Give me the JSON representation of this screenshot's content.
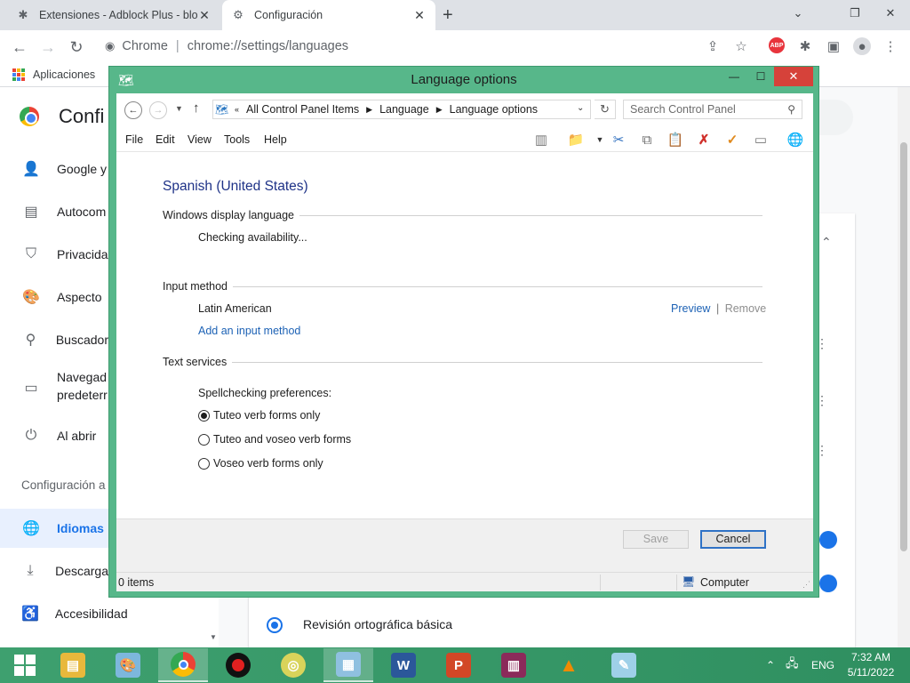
{
  "browser": {
    "tabs": [
      {
        "label": "Extensiones - Adblock Plus - bloq",
        "icon": "puzzle-icon"
      },
      {
        "label": "Configuración",
        "icon": "gear-icon"
      }
    ],
    "omnibox_site": "Chrome",
    "omnibox_url": "chrome://settings/languages",
    "bookmark_apps": "Aplicaciones",
    "abp_label": "ABP"
  },
  "settings": {
    "title": "Confi",
    "sidebar": [
      {
        "label": "Google y",
        "icon": "person-icon"
      },
      {
        "label": "Autocom",
        "icon": "clipboard-icon"
      },
      {
        "label": "Privacida",
        "icon": "shield-icon"
      },
      {
        "label": "Aspecto",
        "icon": "palette-icon"
      },
      {
        "label": "Buscador",
        "icon": "search-icon"
      },
      {
        "label": "Navegad",
        "label2": "predeterr",
        "icon": "browser-icon"
      },
      {
        "label": "Al abrir",
        "icon": "power-icon"
      }
    ],
    "sidebar_section": "Configuración a",
    "sidebar_bottom": [
      {
        "label": "Idiomas",
        "icon": "globe-icon",
        "active": true
      },
      {
        "label": "Descarga",
        "icon": "download-icon"
      },
      {
        "label": "Accesibilidad",
        "icon": "accessibility-icon"
      }
    ],
    "spellcheck_option": "Revisión ortográfica básica"
  },
  "dialog": {
    "title": "Language options",
    "breadcrumb": [
      "All Control Panel Items",
      "Language",
      "Language options"
    ],
    "breadcrumb_prefix": "«",
    "search_placeholder": "Search Control Panel",
    "menu": [
      "File",
      "Edit",
      "View",
      "Tools",
      "Help"
    ],
    "language_name": "Spanish (United States)",
    "display_language": {
      "heading": "Windows display language",
      "status": "Checking availability..."
    },
    "input_method": {
      "heading": "Input method",
      "name": "Latin American",
      "preview": "Preview",
      "separator": "|",
      "remove": "Remove",
      "add": "Add an input method"
    },
    "text_services": {
      "heading": "Text services",
      "spell_label": "Spellchecking preferences:",
      "options": [
        {
          "label": "Tuteo verb forms only",
          "selected": true
        },
        {
          "label": "Tuteo and voseo verb forms",
          "selected": false
        },
        {
          "label": "Voseo verb forms only",
          "selected": false
        }
      ]
    },
    "buttons": {
      "save": "Save",
      "cancel": "Cancel"
    },
    "status": {
      "items": "0 items",
      "location": "Computer"
    }
  },
  "taskbar": {
    "language": "ENG",
    "time": "7:32 AM",
    "date": "5/11/2022"
  }
}
